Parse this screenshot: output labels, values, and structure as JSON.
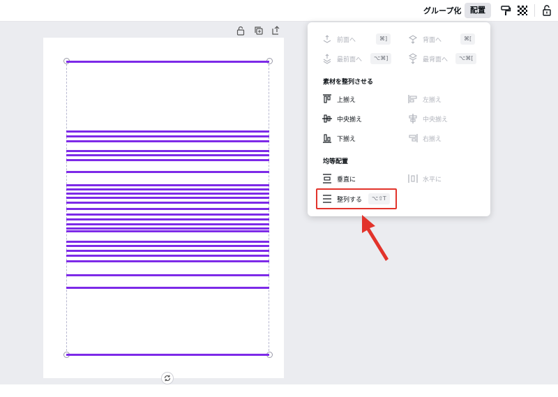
{
  "toolbar": {
    "group_label": "グループ化",
    "arrange_label": "配置",
    "icons": [
      "paint-roller-icon",
      "transparency-icon",
      "lock-icon"
    ]
  },
  "page_tools": {
    "icons": [
      "lock-icon",
      "duplicate-icon",
      "add-page-icon"
    ]
  },
  "menu": {
    "layer_items": [
      {
        "label": "前面へ",
        "shortcut": "⌘]",
        "enabled": false
      },
      {
        "label": "背面へ",
        "shortcut": "⌘[",
        "enabled": false
      },
      {
        "label": "最前面へ",
        "shortcut": "⌥⌘]",
        "enabled": false
      },
      {
        "label": "最背面へ",
        "shortcut": "⌥⌘[",
        "enabled": false
      }
    ],
    "align_title": "素材を整列させる",
    "align_items": [
      {
        "label": "上揃え",
        "enabled": true
      },
      {
        "label": "左揃え",
        "enabled": false
      },
      {
        "label": "中央揃え",
        "enabled": true
      },
      {
        "label": "中央揃え",
        "enabled": false
      },
      {
        "label": "下揃え",
        "enabled": true
      },
      {
        "label": "右揃え",
        "enabled": false
      }
    ],
    "distribute_title": "均等配置",
    "distribute_items": [
      {
        "label": "垂直に",
        "enabled": true
      },
      {
        "label": "水平に",
        "enabled": false
      }
    ],
    "tidy": {
      "label": "整列する",
      "shortcut": "⌥⇧T",
      "enabled": true
    }
  },
  "colors": {
    "accent": "#7d2ae8",
    "highlight": "#e2332b"
  }
}
